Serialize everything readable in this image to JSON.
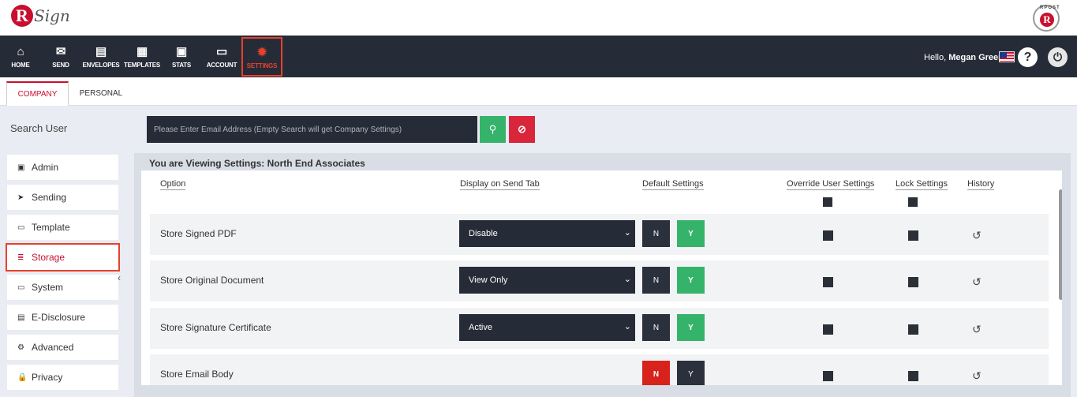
{
  "app": {
    "logo_letter": "R",
    "logo_text": "Sign",
    "badge_text": "RPOST",
    "badge_letter": "R"
  },
  "nav": [
    {
      "label": "HOME",
      "icon": "⌂"
    },
    {
      "label": "SEND",
      "icon": "✉"
    },
    {
      "label": "ENVELOPES",
      "icon": "▤"
    },
    {
      "label": "TEMPLATES",
      "icon": "▦"
    },
    {
      "label": "STATS",
      "icon": "▣"
    },
    {
      "label": "ACCOUNT",
      "icon": "▭"
    },
    {
      "label": "SETTINGS",
      "icon": "✹"
    }
  ],
  "user": {
    "hello": "Hello,",
    "name": "Megan Greene",
    "help": "?",
    "power": "⏻"
  },
  "tabs": {
    "company": "COMPANY",
    "personal": "PERSONAL"
  },
  "search": {
    "label": "Search User",
    "placeholder": "Please Enter Email Address (Empty Search will get Company Settings)",
    "search_icon": "⚲",
    "clear_icon": "⊘"
  },
  "sidebar": [
    {
      "label": "Admin",
      "icon": "▣"
    },
    {
      "label": "Sending",
      "icon": "➤"
    },
    {
      "label": "Template",
      "icon": "▭"
    },
    {
      "label": "Storage",
      "icon": "≣"
    },
    {
      "label": "System",
      "icon": "▭"
    },
    {
      "label": "E-Disclosure",
      "icon": "▤"
    },
    {
      "label": "Advanced",
      "icon": "⚙"
    },
    {
      "label": "Privacy",
      "icon": "🔒"
    }
  ],
  "panel": {
    "title": "You are Viewing Settings: North End Associates",
    "headers": {
      "option": "Option",
      "display": "Display on Send Tab",
      "default": "Default Settings",
      "override": "Override User Settings",
      "lock": "Lock Settings",
      "history": "History"
    },
    "rows": [
      {
        "label": "Store Signed PDF",
        "display": "Disable",
        "n": "N",
        "y": "Y",
        "default": "Y"
      },
      {
        "label": "Store Original Document",
        "display": "View Only",
        "n": "N",
        "y": "Y",
        "default": "Y"
      },
      {
        "label": "Store Signature Certificate",
        "display": "Active",
        "n": "N",
        "y": "Y",
        "default": "Y"
      },
      {
        "label": "Store Email Body",
        "display": "",
        "n": "N",
        "y": "Y",
        "default": "N"
      }
    ]
  },
  "colors": {
    "nav_bg": "#262c37",
    "accent_red": "#c8102e",
    "green": "#36b36a",
    "highlight": "#e8402d"
  }
}
